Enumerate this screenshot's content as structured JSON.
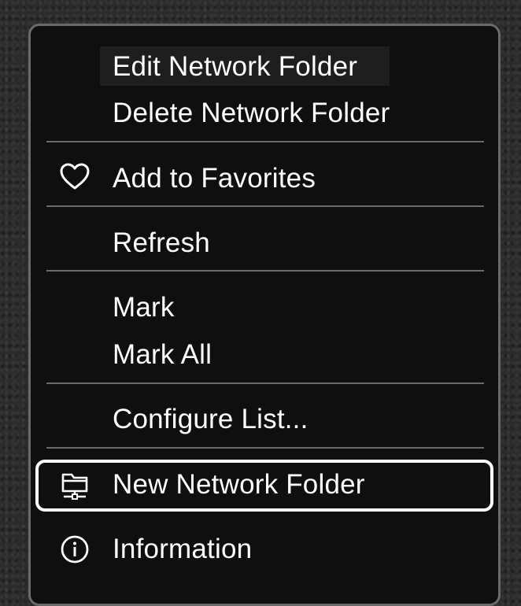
{
  "menu": {
    "items": [
      {
        "label": "Edit Network Folder"
      },
      {
        "label": "Delete Network Folder"
      },
      {
        "label": "Add to Favorites",
        "icon": "heart-icon"
      },
      {
        "label": "Refresh"
      },
      {
        "label": "Mark"
      },
      {
        "label": "Mark All"
      },
      {
        "label": "Configure List..."
      },
      {
        "label": "New Network Folder",
        "icon": "network-folder-icon",
        "selected": true
      },
      {
        "label": "Information",
        "icon": "info-icon"
      }
    ]
  },
  "colors": {
    "menu_background": "#0f0f0f",
    "menu_border": "#6a6a6a",
    "separator": "#6b6b6b",
    "text": "#ffffff",
    "selection_border": "#ffffff"
  }
}
